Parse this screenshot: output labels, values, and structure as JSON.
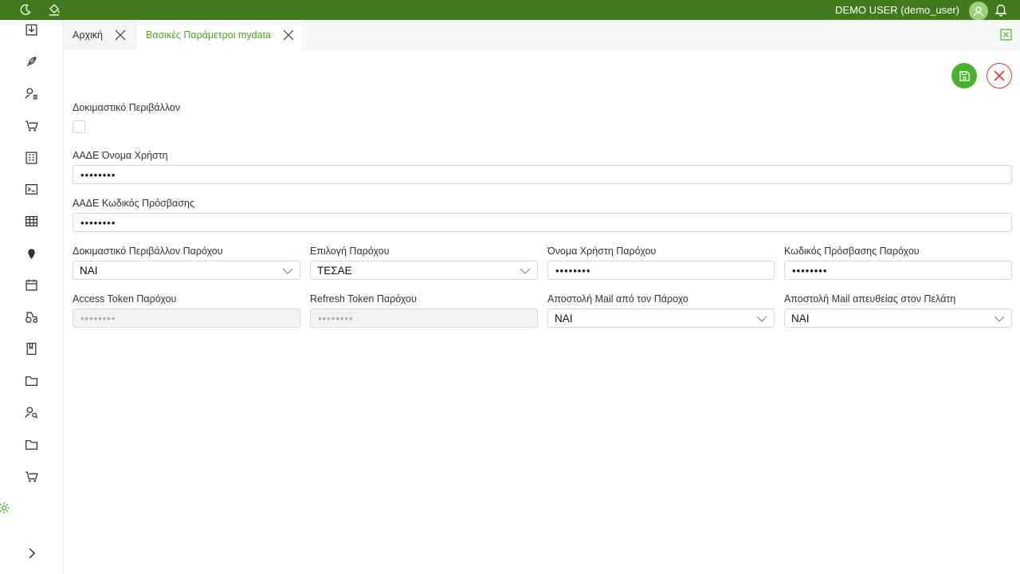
{
  "topbar": {
    "user_name": "DEMO USER (demo_user)",
    "bg_color": "#3f7a1c"
  },
  "tabs": [
    {
      "label": "Αρχική",
      "active": false
    },
    {
      "label": "Βασικές Παράμετροι mydata",
      "active": true
    }
  ],
  "form": {
    "test_env": {
      "label": "Δοκιμαστικό Περιβάλλον",
      "checked": false
    },
    "aade_username": {
      "label": "ΑΑΔΕ Όνομα Χρήστη",
      "value": "••••••••"
    },
    "aade_password": {
      "label": "ΑΑΔΕ Κωδικός Πρόσβασης",
      "value": "••••••••"
    },
    "provider_test_env": {
      "label": "Δοκιμαστικό Περιβάλλον Παρόχου",
      "value": "ΝΑΙ"
    },
    "provider_select": {
      "label": "Επιλογή Παρόχου",
      "value": "ΤΕΣΑΕ"
    },
    "provider_username": {
      "label": "Όνομα Χρήστη Παρόχου",
      "value": "••••••••"
    },
    "provider_password": {
      "label": "Κωδικός Πρόσβασης Παρόχου",
      "value": "••••••••"
    },
    "access_token": {
      "label": "Access Token Παρόχου",
      "value": "••••••••"
    },
    "refresh_token": {
      "label": "Refresh Token Παρόχου",
      "value": "••••••••"
    },
    "mail_from_provider": {
      "label": "Αποστολή Mail από τον Πάροχο",
      "value": "ΝΑΙ"
    },
    "mail_to_customer": {
      "label": "Αποστολή Mail απευθείας στον Πελάτη",
      "value": "ΝΑΙ"
    }
  },
  "colors": {
    "accent": "#48b22a",
    "active_tab_text": "#4caa1e",
    "cancel": "#e03333"
  },
  "icons": {
    "topbar": [
      "moon-icon",
      "paint-bucket-icon",
      "user-avatar-icon",
      "bell-icon"
    ],
    "sidebar": [
      "inbox-icon",
      "feather-icon",
      "user-list-icon",
      "cart-icon",
      "building-icon",
      "terminal-icon",
      "table-icon",
      "location-icon",
      "calendar-icon",
      "tractor-icon",
      "bookmark-icon",
      "folder-icon",
      "user-search-icon",
      "folder-icon",
      "cart-icon",
      "gear-icon",
      "chevron-right-icon"
    ]
  }
}
